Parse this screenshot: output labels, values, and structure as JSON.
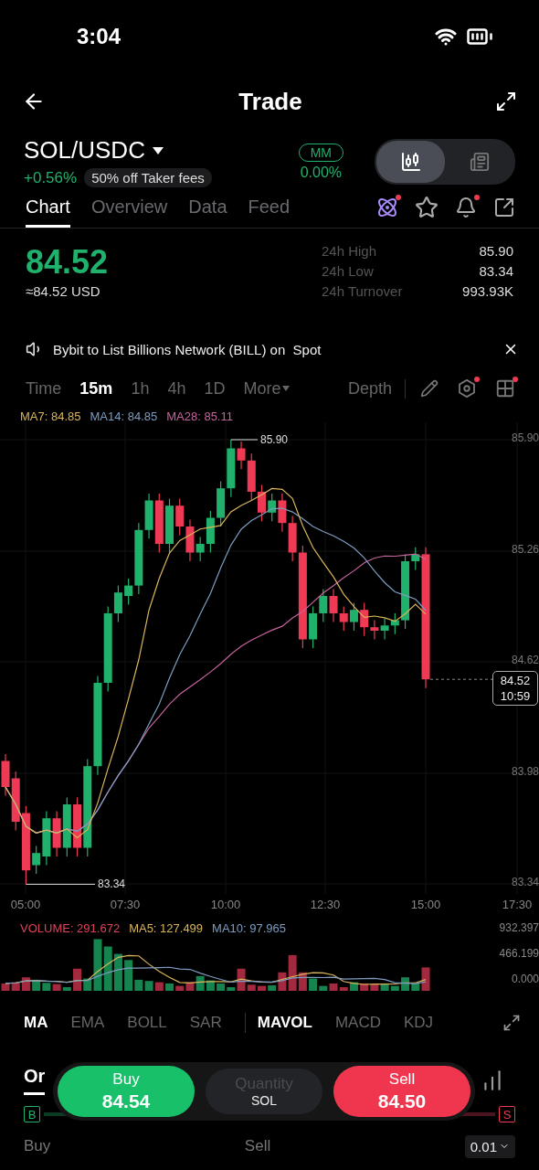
{
  "status_bar": {
    "time": "3:04"
  },
  "header": {
    "title": "Trade"
  },
  "pair": {
    "symbol": "SOL/USDC",
    "change": "+0.56%",
    "promo": "50% off Taker fees",
    "mm_label": "MM",
    "mm_value": "0.00%"
  },
  "view_toggle": [
    {
      "kind": "candles",
      "selected": true
    },
    {
      "kind": "news",
      "selected": false
    }
  ],
  "tabs": [
    {
      "label": "Chart",
      "selected": true
    },
    {
      "label": "Overview",
      "selected": false
    },
    {
      "label": "Data",
      "selected": false
    },
    {
      "label": "Feed",
      "selected": false
    }
  ],
  "tab_icons": [
    {
      "kind": "atom",
      "dot": true
    },
    {
      "kind": "star",
      "dot": false
    },
    {
      "kind": "bell",
      "dot": true
    },
    {
      "kind": "share",
      "dot": false
    }
  ],
  "price": {
    "last": "84.52",
    "usd": "≈84.52 USD"
  },
  "stats": [
    {
      "label": "24h High",
      "value": "85.90"
    },
    {
      "label": "24h Low",
      "value": "83.34"
    },
    {
      "label": "24h Turnover",
      "value": "993.93K"
    }
  ],
  "announcement": {
    "text": "Bybit to List Billions Network (BILL) on  Spot"
  },
  "timeframes": [
    {
      "label": "Time",
      "selected": false
    },
    {
      "label": "15m",
      "selected": true
    },
    {
      "label": "1h",
      "selected": false
    },
    {
      "label": "4h",
      "selected": false
    },
    {
      "label": "1D",
      "selected": false
    },
    {
      "label": "More",
      "selected": false,
      "caret": true
    }
  ],
  "depth": "Depth",
  "chart_tools": [
    {
      "kind": "pencil",
      "dot": false
    },
    {
      "kind": "hexagon",
      "dot": true
    },
    {
      "kind": "grid",
      "dot": true
    }
  ],
  "ma_legend": [
    {
      "text": "MA7: 84.85",
      "color": "#d9b55c"
    },
    {
      "text": "MA14: 84.85",
      "color": "#7d9cc0"
    },
    {
      "text": "MA28: 85.11",
      "color": "#c4649c"
    }
  ],
  "chart": {
    "price_axis": [
      "85.90",
      "85.26",
      "84.62",
      "83.98",
      "83.34"
    ],
    "time_axis": [
      "05:00",
      "07:30",
      "10:00",
      "12:30",
      "15:00",
      "17:30"
    ],
    "high": "85.90",
    "low": "83.34",
    "last_price": "84.52",
    "countdown": "10:59"
  },
  "volume": {
    "legend": [
      {
        "text": "VOLUME: 291.672",
        "color": "#e0415a"
      },
      {
        "text": "MA5: 127.499",
        "color": "#d9b55c"
      },
      {
        "text": "MA10: 97.965",
        "color": "#7d9cc0"
      }
    ],
    "axis": [
      "932.397",
      "466.199",
      "0.000"
    ]
  },
  "indicator_groups": [
    [
      {
        "label": "MA",
        "selected": true
      },
      {
        "label": "EMA",
        "selected": false
      },
      {
        "label": "BOLL",
        "selected": false
      },
      {
        "label": "SAR",
        "selected": false
      }
    ],
    [
      {
        "label": "MAVOL",
        "selected": true
      },
      {
        "label": "MACD",
        "selected": false
      },
      {
        "label": "KDJ",
        "selected": false
      }
    ]
  ],
  "order_tab": "Or",
  "trade_bar": {
    "buy_label": "Buy",
    "buy_price": "84.54",
    "qty_placeholder": "Quantity",
    "qty_unit": "SOL",
    "sell_label": "Sell",
    "sell_price": "84.50"
  },
  "book": {
    "buy_badge": "B",
    "sell_badge": "S",
    "buy_header": "Buy",
    "sell_header": "Sell",
    "step": "0.01"
  }
}
